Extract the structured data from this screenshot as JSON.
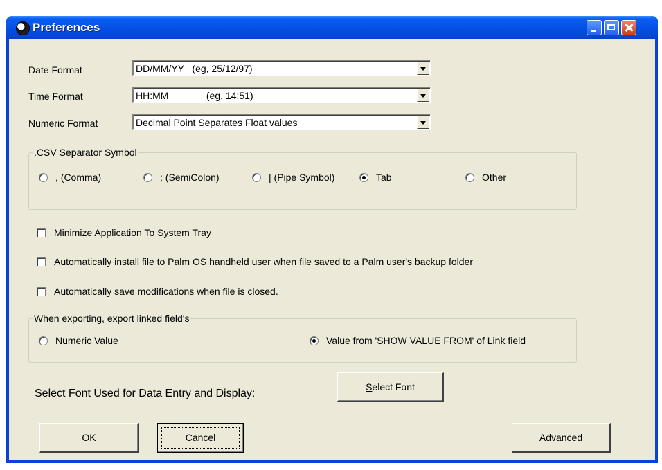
{
  "window": {
    "title": "Preferences"
  },
  "date_format": {
    "label": "Date Format",
    "value": "DD/MM/YY   (eg, 25/12/97)"
  },
  "time_format": {
    "label": "Time Format",
    "value": "HH:MM              (eg, 14:51)"
  },
  "numeric_format": {
    "label": "Numeric Format",
    "value": "Decimal Point Separates Float values"
  },
  "csv_group": {
    "legend": ".CSV Separator Symbol",
    "options": [
      ", (Comma)",
      "; (SemiColon)",
      "| (Pipe Symbol)",
      "Tab",
      "Other"
    ],
    "selected": "Tab"
  },
  "checkboxes": [
    "Minimize Application To System Tray",
    "Automatically install file to Palm OS handheld user when file saved to a Palm user's backup folder",
    "Automatically save modifications when file is closed."
  ],
  "export_group": {
    "legend": "When exporting, export linked field's",
    "options": [
      "Numeric Value",
      "Value from 'SHOW VALUE FROM' of Link field"
    ],
    "selected": "Value from 'SHOW VALUE FROM' of Link field"
  },
  "font": {
    "label": "Select Font Used for Data Entry and Display:",
    "button_first": "S",
    "button_rest": "elect Font"
  },
  "buttons": {
    "ok_first": "O",
    "ok_rest": "K",
    "cancel_first": "C",
    "cancel_rest": "ancel",
    "advanced_first": "A",
    "advanced_rest": "dvanced"
  }
}
